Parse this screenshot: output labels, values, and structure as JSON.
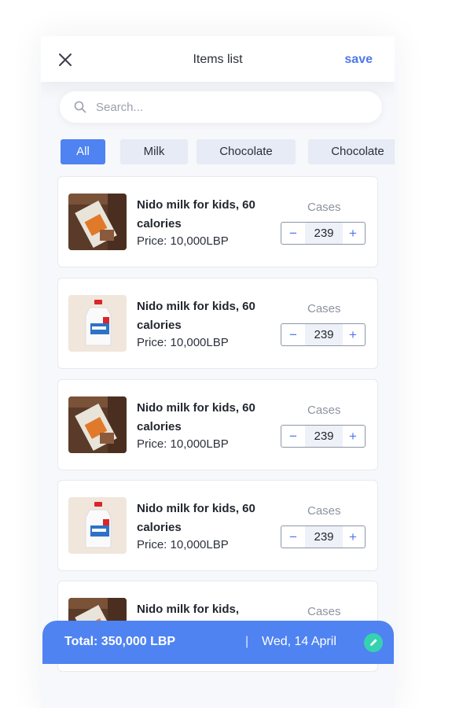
{
  "header": {
    "title": "Items list",
    "save_label": "save"
  },
  "search": {
    "placeholder": "Search...",
    "value": ""
  },
  "filters": [
    {
      "label": "All",
      "active": true
    },
    {
      "label": "Milk",
      "active": false
    },
    {
      "label": "Chocolate",
      "active": false
    },
    {
      "label": "Chocolate",
      "active": false
    },
    {
      "label": "",
      "active": false
    }
  ],
  "items": [
    {
      "name": "Nido milk for kids, 60 calories",
      "price": "Price: 10,000LBP",
      "cases_label": "Cases",
      "quantity": "239",
      "image": "chocolate-product"
    },
    {
      "name": "Nido milk for kids, 60 calories",
      "price": "Price: 10,000LBP",
      "cases_label": "Cases",
      "quantity": "239",
      "image": "milk-jug"
    },
    {
      "name": "Nido milk for kids, 60 calories",
      "price": "Price: 10,000LBP",
      "cases_label": "Cases",
      "quantity": "239",
      "image": "chocolate-product"
    },
    {
      "name": "Nido milk for kids, 60 calories",
      "price": "Price: 10,000LBP",
      "cases_label": "Cases",
      "quantity": "239",
      "image": "milk-jug"
    },
    {
      "name": "Nido milk for kids,",
      "price": "",
      "cases_label": "Cases",
      "quantity": "",
      "image": "chocolate-product"
    }
  ],
  "stepper": {
    "minus": "−",
    "plus": "+"
  },
  "footer": {
    "total": "Total: 350,000 LBP",
    "divider": "|",
    "date": "Wed, 14 April"
  },
  "icons": {
    "close": "close-icon",
    "search": "search-icon",
    "edit": "pencil-icon"
  },
  "colors": {
    "accent": "#4f83f2",
    "link": "#4f78ec",
    "edit": "#36d2b0"
  }
}
